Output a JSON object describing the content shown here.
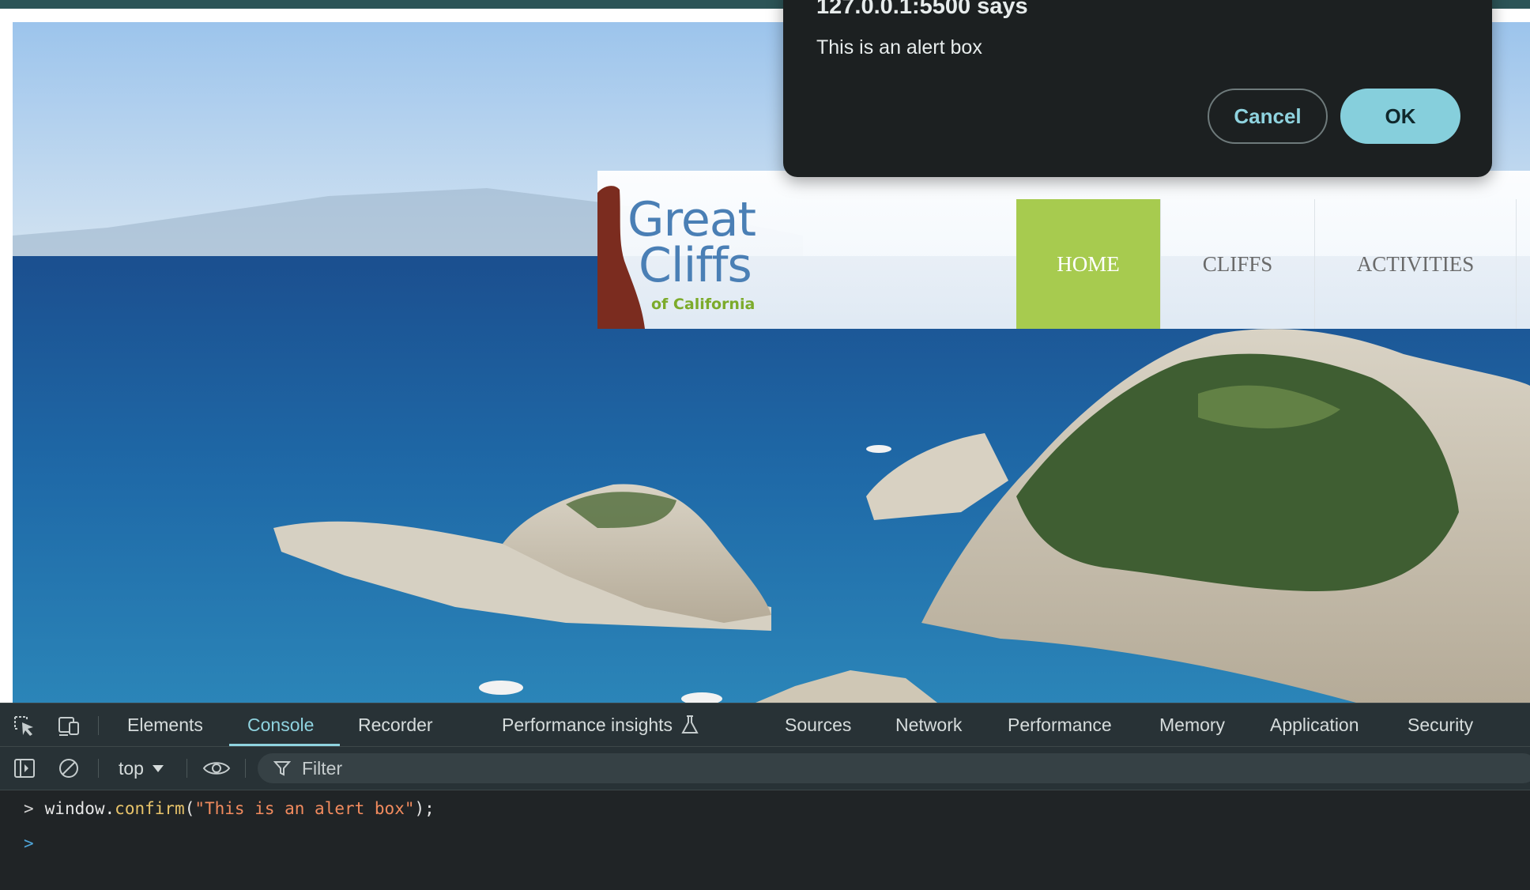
{
  "dialog": {
    "title": "127.0.0.1:5500 says",
    "message": "This is an alert box",
    "cancel_label": "Cancel",
    "ok_label": "OK"
  },
  "site": {
    "logo": {
      "word1": "Great",
      "word2": "Cliffs",
      "sub": "of California"
    },
    "nav": [
      {
        "label": "HOME",
        "active": true
      },
      {
        "label": "CLIFFS",
        "active": false
      },
      {
        "label": "ACTIVITIES",
        "active": false
      }
    ]
  },
  "devtools": {
    "tabs": [
      {
        "label": "Elements"
      },
      {
        "label": "Console",
        "active": true
      },
      {
        "label": "Recorder"
      },
      {
        "label": "Performance insights"
      },
      {
        "label": "Sources"
      },
      {
        "label": "Network"
      },
      {
        "label": "Performance"
      },
      {
        "label": "Memory"
      },
      {
        "label": "Application"
      },
      {
        "label": "Security"
      }
    ],
    "toolbar": {
      "context": "top",
      "filter_placeholder": "Filter"
    },
    "console": {
      "obj": "window",
      "dot": ".",
      "fn": "confirm",
      "open": "(",
      "arg": "\"This is an alert box\"",
      "close": ");"
    }
  },
  "colors": {
    "accent": "#8fd3df",
    "nav_active": "#a7cb4f",
    "dialog_bg": "#1c2021",
    "devtools_bg": "#202426"
  }
}
